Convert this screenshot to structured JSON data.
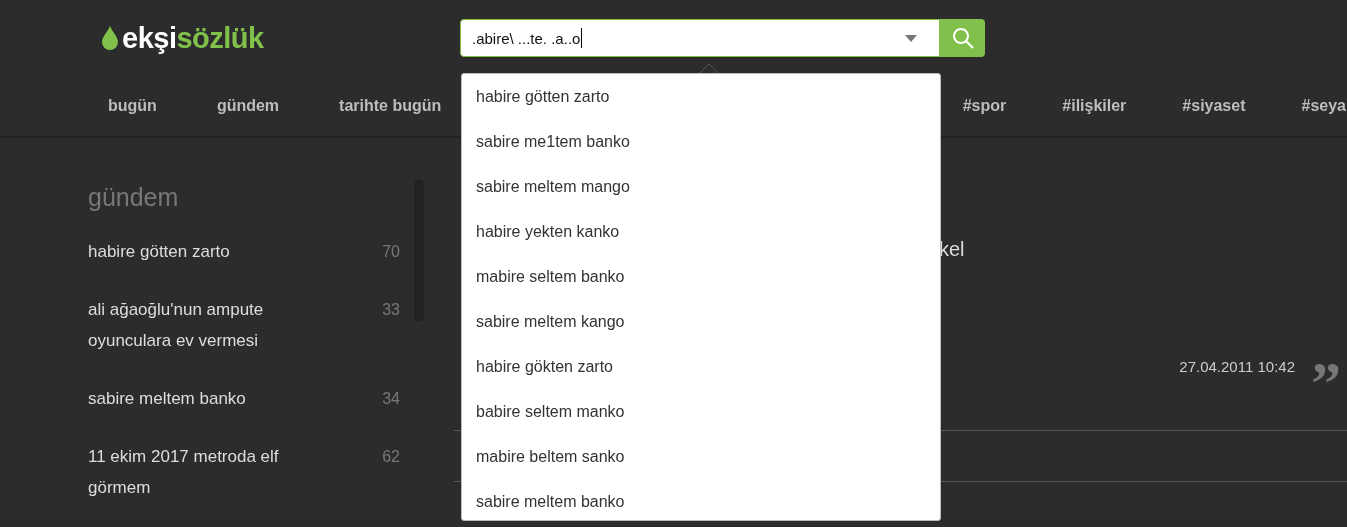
{
  "logo": {
    "part_1": "ekşi",
    "part_2": "sözlük"
  },
  "search": {
    "value": ".abire\\ ...te. .a..o",
    "suggestions": [
      {
        "text": "habire götten zarto"
      },
      {
        "text": "sabire me1tem banko"
      },
      {
        "text": "sabire meltem mango"
      },
      {
        "text": "habire yekten kanko"
      },
      {
        "text": "mabire seltem banko"
      },
      {
        "text": "sabire meltem kango"
      },
      {
        "text": "habire gökten zarto"
      },
      {
        "text": "babire seltem manko"
      },
      {
        "text": "mabire beltem sanko"
      },
      {
        "text": "sabire meltem banko"
      }
    ]
  },
  "nav": {
    "left": [
      "bugün",
      "gündem",
      "tarihte bugün"
    ],
    "right": [
      "#spor",
      "#ilişkiler",
      "#siyaset",
      "#seya"
    ]
  },
  "sidebar": {
    "title": "gündem",
    "items": [
      {
        "title": "habire götten zarto",
        "count": "70"
      },
      {
        "title": "ali ağaoğlu'nun ampute oyunculara ev vermesi",
        "count": "33"
      },
      {
        "title": "sabire meltem banko",
        "count": "34"
      },
      {
        "title": "11 ekim 2017 metroda elf görmem",
        "count": "62"
      }
    ]
  },
  "entry": {
    "title_fragment": "kel",
    "date": "27.04.2011 10:42",
    "quote_mark": "”"
  }
}
